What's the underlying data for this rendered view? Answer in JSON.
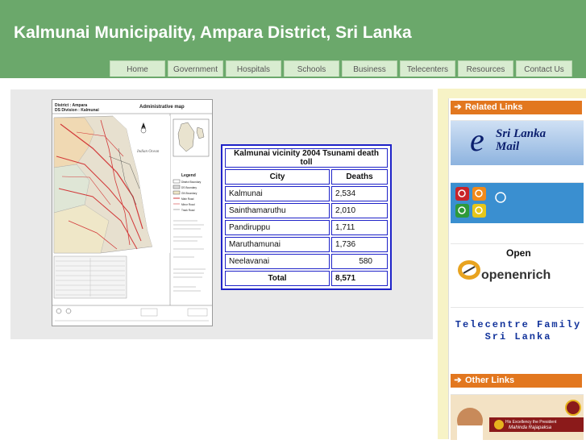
{
  "header": {
    "title": "Kalmunai Municipality, Ampara District, Sri Lanka"
  },
  "nav": [
    "Home",
    "Government",
    "Hospitals",
    "Schools",
    "Business",
    "Telecenters",
    "Resources",
    "Contact Us"
  ],
  "map": {
    "header_left_1": "District : Ampara",
    "header_left_2": "DS Division : Kalmunai",
    "header_right": "Administrative map",
    "ocean_label": "Indian Ocean",
    "legend_title": "Legend",
    "legend_items": [
      "District Boundary",
      "DS Boundary",
      "GN Boundary",
      "Main Road",
      "Minor Road",
      "Track Road"
    ]
  },
  "tsunami_table": {
    "caption": "Kalmunai vicinity 2004 Tsunami death toll",
    "headers": [
      "City",
      "Deaths"
    ],
    "rows": [
      [
        "Kalmunai",
        "2,534"
      ],
      [
        "Sainthamaruthu",
        "2,010"
      ],
      [
        "Pandiruppu",
        "1,711"
      ],
      [
        "Maruthamunai",
        "1,736"
      ],
      [
        "Neelavanai",
        "580"
      ]
    ],
    "total_label": "Total",
    "total_value": "8,571"
  },
  "sidebar": {
    "related_title": "Related Links",
    "other_title": "Other Links",
    "esrilanka": {
      "line1": "Sri Lanka",
      "line2": "Mail"
    },
    "openenrich": {
      "top": "Open",
      "brand": "openenrich"
    },
    "telecentre": "Telecentre Family Sri Lanka",
    "president": {
      "line1": "His Excellency the President",
      "line2": "Mahinda Rajapaksa"
    }
  },
  "colors": {
    "header_green": "#6ba86b",
    "nav_bg": "#d8ecd0",
    "table_border": "#1e22c8",
    "side_head": "#e2771f",
    "side_strip": "#f7f3c6"
  }
}
